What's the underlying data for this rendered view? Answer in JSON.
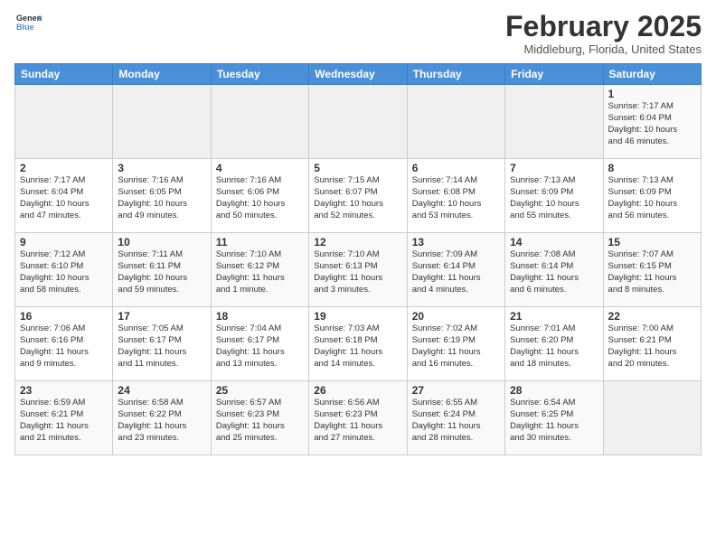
{
  "header": {
    "logo_general": "General",
    "logo_blue": "Blue",
    "month": "February 2025",
    "location": "Middleburg, Florida, United States"
  },
  "weekdays": [
    "Sunday",
    "Monday",
    "Tuesday",
    "Wednesday",
    "Thursday",
    "Friday",
    "Saturday"
  ],
  "weeks": [
    [
      {
        "day": "",
        "info": ""
      },
      {
        "day": "",
        "info": ""
      },
      {
        "day": "",
        "info": ""
      },
      {
        "day": "",
        "info": ""
      },
      {
        "day": "",
        "info": ""
      },
      {
        "day": "",
        "info": ""
      },
      {
        "day": "1",
        "info": "Sunrise: 7:17 AM\nSunset: 6:04 PM\nDaylight: 10 hours\nand 46 minutes."
      }
    ],
    [
      {
        "day": "2",
        "info": "Sunrise: 7:17 AM\nSunset: 6:04 PM\nDaylight: 10 hours\nand 47 minutes."
      },
      {
        "day": "3",
        "info": "Sunrise: 7:16 AM\nSunset: 6:05 PM\nDaylight: 10 hours\nand 49 minutes."
      },
      {
        "day": "4",
        "info": "Sunrise: 7:16 AM\nSunset: 6:06 PM\nDaylight: 10 hours\nand 50 minutes."
      },
      {
        "day": "5",
        "info": "Sunrise: 7:15 AM\nSunset: 6:07 PM\nDaylight: 10 hours\nand 52 minutes."
      },
      {
        "day": "6",
        "info": "Sunrise: 7:14 AM\nSunset: 6:08 PM\nDaylight: 10 hours\nand 53 minutes."
      },
      {
        "day": "7",
        "info": "Sunrise: 7:13 AM\nSunset: 6:09 PM\nDaylight: 10 hours\nand 55 minutes."
      },
      {
        "day": "8",
        "info": "Sunrise: 7:13 AM\nSunset: 6:09 PM\nDaylight: 10 hours\nand 56 minutes."
      }
    ],
    [
      {
        "day": "9",
        "info": "Sunrise: 7:12 AM\nSunset: 6:10 PM\nDaylight: 10 hours\nand 58 minutes."
      },
      {
        "day": "10",
        "info": "Sunrise: 7:11 AM\nSunset: 6:11 PM\nDaylight: 10 hours\nand 59 minutes."
      },
      {
        "day": "11",
        "info": "Sunrise: 7:10 AM\nSunset: 6:12 PM\nDaylight: 11 hours\nand 1 minute."
      },
      {
        "day": "12",
        "info": "Sunrise: 7:10 AM\nSunset: 6:13 PM\nDaylight: 11 hours\nand 3 minutes."
      },
      {
        "day": "13",
        "info": "Sunrise: 7:09 AM\nSunset: 6:14 PM\nDaylight: 11 hours\nand 4 minutes."
      },
      {
        "day": "14",
        "info": "Sunrise: 7:08 AM\nSunset: 6:14 PM\nDaylight: 11 hours\nand 6 minutes."
      },
      {
        "day": "15",
        "info": "Sunrise: 7:07 AM\nSunset: 6:15 PM\nDaylight: 11 hours\nand 8 minutes."
      }
    ],
    [
      {
        "day": "16",
        "info": "Sunrise: 7:06 AM\nSunset: 6:16 PM\nDaylight: 11 hours\nand 9 minutes."
      },
      {
        "day": "17",
        "info": "Sunrise: 7:05 AM\nSunset: 6:17 PM\nDaylight: 11 hours\nand 11 minutes."
      },
      {
        "day": "18",
        "info": "Sunrise: 7:04 AM\nSunset: 6:17 PM\nDaylight: 11 hours\nand 13 minutes."
      },
      {
        "day": "19",
        "info": "Sunrise: 7:03 AM\nSunset: 6:18 PM\nDaylight: 11 hours\nand 14 minutes."
      },
      {
        "day": "20",
        "info": "Sunrise: 7:02 AM\nSunset: 6:19 PM\nDaylight: 11 hours\nand 16 minutes."
      },
      {
        "day": "21",
        "info": "Sunrise: 7:01 AM\nSunset: 6:20 PM\nDaylight: 11 hours\nand 18 minutes."
      },
      {
        "day": "22",
        "info": "Sunrise: 7:00 AM\nSunset: 6:21 PM\nDaylight: 11 hours\nand 20 minutes."
      }
    ],
    [
      {
        "day": "23",
        "info": "Sunrise: 6:59 AM\nSunset: 6:21 PM\nDaylight: 11 hours\nand 21 minutes."
      },
      {
        "day": "24",
        "info": "Sunrise: 6:58 AM\nSunset: 6:22 PM\nDaylight: 11 hours\nand 23 minutes."
      },
      {
        "day": "25",
        "info": "Sunrise: 6:57 AM\nSunset: 6:23 PM\nDaylight: 11 hours\nand 25 minutes."
      },
      {
        "day": "26",
        "info": "Sunrise: 6:56 AM\nSunset: 6:23 PM\nDaylight: 11 hours\nand 27 minutes."
      },
      {
        "day": "27",
        "info": "Sunrise: 6:55 AM\nSunset: 6:24 PM\nDaylight: 11 hours\nand 28 minutes."
      },
      {
        "day": "28",
        "info": "Sunrise: 6:54 AM\nSunset: 6:25 PM\nDaylight: 11 hours\nand 30 minutes."
      },
      {
        "day": "",
        "info": ""
      }
    ]
  ]
}
